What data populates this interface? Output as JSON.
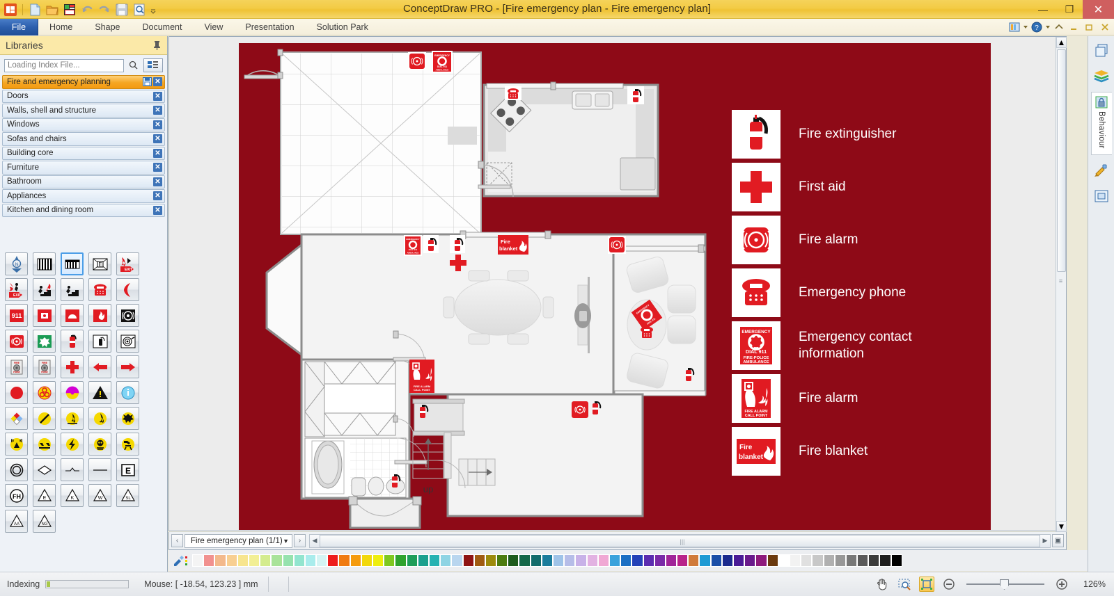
{
  "window": {
    "title": "ConceptDraw PRO - [Fire emergency plan - Fire emergency plan]",
    "minimize": "—",
    "restore": "❐",
    "close": "✕"
  },
  "quick_access": {
    "icons": [
      "app-logo-icon",
      "new-document-icon",
      "open-folder-icon",
      "solution-park-icon",
      "undo-icon",
      "redo-icon",
      "save-icon",
      "print-preview-icon",
      "customize-qat-icon"
    ]
  },
  "ribbon": {
    "tabs": [
      {
        "label": "File",
        "active": true
      },
      {
        "label": "Home",
        "active": false
      },
      {
        "label": "Shape",
        "active": false
      },
      {
        "label": "Document",
        "active": false
      },
      {
        "label": "View",
        "active": false
      },
      {
        "label": "Presentation",
        "active": false
      },
      {
        "label": "Solution Park",
        "active": false
      }
    ],
    "right_icons": [
      "ribbon-display-icon",
      "chevron-down-icon",
      "help-icon",
      "chevron-down-icon",
      "collapse-ribbon-icon",
      "doc-minimize-icon",
      "doc-restore-icon",
      "doc-close-icon"
    ]
  },
  "libraries_panel": {
    "title": "Libraries",
    "pin_icon": "pin-icon",
    "search": {
      "placeholder": "Loading Index File...",
      "value": "",
      "search_icon": "search-icon",
      "view_icon": "tree-view-icon"
    },
    "items": [
      {
        "label": "Fire and emergency planning",
        "active": true,
        "has_save": true
      },
      {
        "label": "Doors",
        "active": false,
        "has_save": false
      },
      {
        "label": "Walls, shell and structure",
        "active": false,
        "has_save": false
      },
      {
        "label": "Windows",
        "active": false,
        "has_save": false
      },
      {
        "label": "Sofas and chairs",
        "active": false,
        "has_save": false
      },
      {
        "label": "Building core",
        "active": false,
        "has_save": false
      },
      {
        "label": "Furniture",
        "active": false,
        "has_save": false
      },
      {
        "label": "Bathroom",
        "active": false,
        "has_save": false
      },
      {
        "label": "Appliances",
        "active": false,
        "has_save": false
      },
      {
        "label": "Kitchen and dining room",
        "active": false,
        "has_save": false
      }
    ],
    "close_glyph": "✕",
    "shapes": [
      {
        "name": "north-compass-icon",
        "selected": false
      },
      {
        "name": "ladder-icon",
        "selected": false
      },
      {
        "name": "fire-escape-ladder-icon",
        "selected": true
      },
      {
        "name": "emergency-exit-e-icon",
        "selected": false
      },
      {
        "name": "fire-exit-right-icon",
        "selected": false
      },
      {
        "name": "fire-exit-person-icon",
        "selected": false
      },
      {
        "name": "fire-escape-stairs-icon",
        "selected": false
      },
      {
        "name": "fire-escape-stairs-2-icon",
        "selected": false
      },
      {
        "name": "emergency-phone-icon",
        "selected": false
      },
      {
        "name": "phone-handset-icon",
        "selected": false
      },
      {
        "name": "dial-911-icon",
        "selected": false
      },
      {
        "name": "fire-alarm-box-icon",
        "selected": false
      },
      {
        "name": "fire-hood-icon",
        "selected": false
      },
      {
        "name": "fire-blanket-icon",
        "selected": false
      },
      {
        "name": "alarm-bell-black-icon",
        "selected": false
      },
      {
        "name": "fire-alarm-red-icon",
        "selected": false
      },
      {
        "name": "assembly-point-icon",
        "selected": false
      },
      {
        "name": "fire-extinguisher-icon",
        "selected": false
      },
      {
        "name": "extinguisher-outline-icon",
        "selected": false
      },
      {
        "name": "fire-hose-reel-icon",
        "selected": false
      },
      {
        "name": "fire-hose-cabinet-icon",
        "selected": false
      },
      {
        "name": "fire-hose-cabinet-2-icon",
        "selected": false
      },
      {
        "name": "first-aid-cross-icon",
        "selected": false
      },
      {
        "name": "arrow-left-icon",
        "selected": false
      },
      {
        "name": "arrow-right-icon",
        "selected": false
      },
      {
        "name": "red-circle-icon",
        "selected": false
      },
      {
        "name": "biohazard-icon",
        "selected": false
      },
      {
        "name": "radiation-icon",
        "selected": false
      },
      {
        "name": "warning-triangle-icon",
        "selected": false
      },
      {
        "name": "information-icon",
        "selected": false
      },
      {
        "name": "hazard-diamond-icon",
        "selected": false
      },
      {
        "name": "no-entry-slash-icon",
        "selected": false
      },
      {
        "name": "flammable-icon",
        "selected": false
      },
      {
        "name": "flammable-2-icon",
        "selected": false
      },
      {
        "name": "explosive-icon",
        "selected": false
      },
      {
        "name": "radio-waves-icon",
        "selected": false
      },
      {
        "name": "corrosive-icon",
        "selected": false
      },
      {
        "name": "electric-shock-icon",
        "selected": false
      },
      {
        "name": "toxic-gas-mask-icon",
        "selected": false
      },
      {
        "name": "moving-machinery-icon",
        "selected": false
      },
      {
        "name": "circle-outline-icon",
        "selected": false
      },
      {
        "name": "diamond-outline-icon",
        "selected": false
      },
      {
        "name": "line-break-icon",
        "selected": false
      },
      {
        "name": "line-icon",
        "selected": false
      },
      {
        "name": "exit-e-box-icon",
        "selected": false
      },
      {
        "name": "fire-hydrant-fh-icon",
        "selected": false
      },
      {
        "name": "triangle-e-icon",
        "selected": false
      },
      {
        "name": "triangle-k-icon",
        "selected": false
      },
      {
        "name": "triangle-w-icon",
        "selected": false
      },
      {
        "name": "triangle-sl-icon",
        "selected": false
      },
      {
        "name": "triangle-aa-icon",
        "selected": false
      },
      {
        "name": "triangle-ng-icon",
        "selected": false
      }
    ]
  },
  "canvas": {
    "background_color": "#8e0a17",
    "floor_color": "#f2f2f2",
    "stair_label": "up"
  },
  "legend": {
    "items": [
      {
        "label": "Fire extinguisher",
        "icon": "fire-extinguisher-icon"
      },
      {
        "label": "First aid",
        "icon": "first-aid-cross-icon"
      },
      {
        "label": "Fire alarm",
        "icon": "fire-alarm-bell-icon"
      },
      {
        "label": "Emergency phone",
        "icon": "emergency-phone-icon"
      },
      {
        "label": "Emergency contact information",
        "icon": "dial-911-icon"
      },
      {
        "label": "Fire alarm",
        "icon": "fire-alarm-call-point-icon"
      },
      {
        "label": "Fire blanket",
        "icon": "fire-blanket-icon"
      }
    ],
    "sign_texts": {
      "emergency": "EMERGENCY",
      "dial": "DIAL 911",
      "services": "FIRE-POLICE",
      "ambulance": "AMBULANCE",
      "call_point_1": "FIRE ALARM",
      "call_point_2": "CALL POINT",
      "blanket_1": "Fire",
      "blanket_2": "blanket"
    }
  },
  "pagebar": {
    "prev": "‹",
    "next": "›",
    "tab_label": "Fire emergency plan (1/1)",
    "dropdown": "▼",
    "left_arrow": "◀",
    "right_arrow": "▶",
    "grip": "|||"
  },
  "palette": {
    "colors": [
      "#f4f4f4",
      "#f1918f",
      "#f3b98c",
      "#f8cf92",
      "#f7e58f",
      "#f2ef95",
      "#d4ec8e",
      "#a9e39a",
      "#96e2ae",
      "#92e5cf",
      "#a9ecec",
      "#d4f4f4",
      "#ee1c1c",
      "#f07b12",
      "#f59b0e",
      "#f2d80c",
      "#eeee0e",
      "#7ec820",
      "#2ea32e",
      "#1e9e5a",
      "#1aa08e",
      "#26b2b2",
      "#8ed4e4",
      "#b9d6ef",
      "#8e1414",
      "#a05b12",
      "#9c8a0c",
      "#4c7c10",
      "#1d5c1d",
      "#14684a",
      "#126c6c",
      "#1a7c9c",
      "#9fc3e8",
      "#b6bde8",
      "#c8b2e8",
      "#e2b2e2",
      "#f0a8d4",
      "#3aa2dc",
      "#1b6fc4",
      "#2342b8",
      "#5b2cb0",
      "#7a2aa8",
      "#a02499",
      "#b8238a",
      "#d07a3a",
      "#1e9ad4",
      "#1a4fa8",
      "#1b2b8e",
      "#4a1b96",
      "#6a1a8c",
      "#8e1a7c",
      "#6b3a0e",
      "#ffffff",
      "#f2f2f2",
      "#e0e0e0",
      "#c8c8c8",
      "#b0b0b0",
      "#989898",
      "#787878",
      "#5a5a5a",
      "#3c3c3c",
      "#1e1e1e",
      "#000000"
    ],
    "picker_icon": "color-picker-icon"
  },
  "statusbar": {
    "indexing_label": "Indexing",
    "progress_percent": 4,
    "mouse_label": "Mouse: [ -18.54, 123.23 ] mm",
    "tools": [
      {
        "name": "pan-hand-icon",
        "active": false
      },
      {
        "name": "zoom-marquee-icon",
        "active": false
      },
      {
        "name": "fit-to-window-icon",
        "active": true
      }
    ],
    "zoom_out": "−",
    "zoom_in": "+",
    "zoom_percent": "126%"
  },
  "right_dock": {
    "items": [
      {
        "name": "layers-icon",
        "label": ""
      },
      {
        "name": "library-books-icon",
        "label": ""
      },
      {
        "name": "behaviour-lock-icon",
        "label": "Behaviour"
      },
      {
        "name": "format-painter-icon",
        "label": ""
      },
      {
        "name": "frame-icon",
        "label": ""
      }
    ]
  }
}
